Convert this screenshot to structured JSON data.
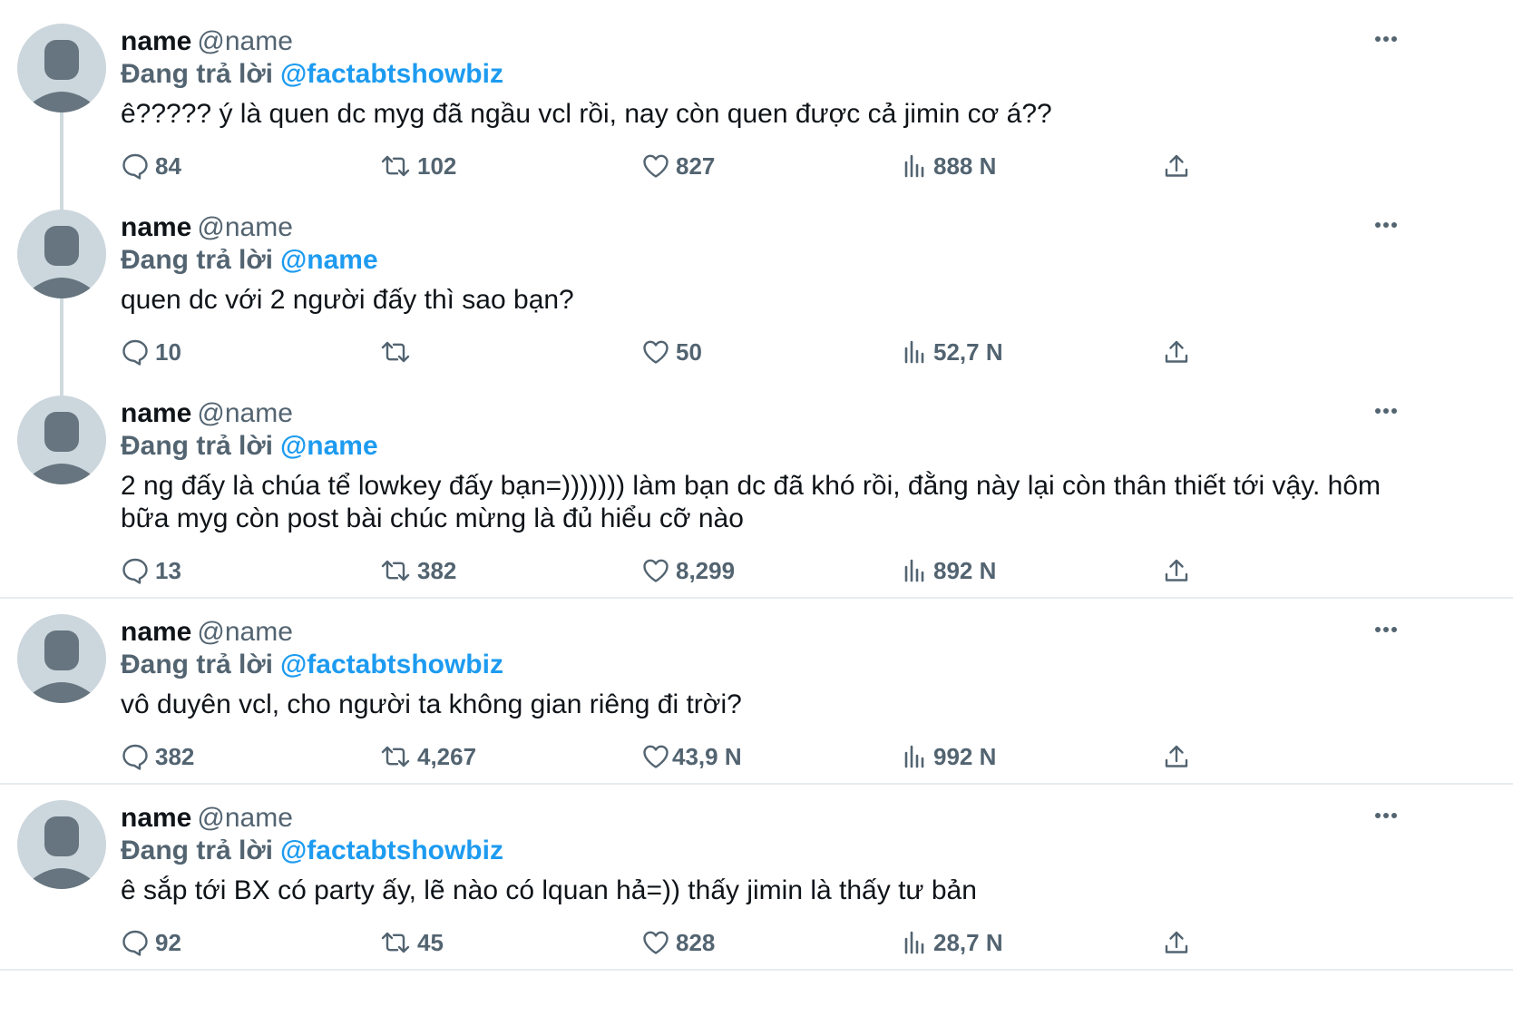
{
  "tweets": [
    {
      "name": "name",
      "handle": "@name",
      "reply_prefix": "Đang trả lời",
      "reply_to": "@factabtshowbiz",
      "text": "ê????? ý là quen dc myg đã ngầu vcl rồi, nay còn quen được cả jimin cơ á??",
      "replies": "84",
      "retweets": "102",
      "likes": "827",
      "views": "888 N"
    },
    {
      "name": "name",
      "handle": "@name",
      "reply_prefix": "Đang trả lời",
      "reply_to": "@name",
      "text": "quen dc với 2 người đấy thì sao bạn?",
      "replies": "10",
      "retweets": "",
      "likes": "50",
      "views": "52,7 N"
    },
    {
      "name": "name",
      "handle": "@name",
      "reply_prefix": "Đang trả lời",
      "reply_to": "@name",
      "text": "2 ng đấy là chúa tể lowkey đấy bạn=))))))) làm bạn dc đã khó rồi, đằng này lại còn thân thiết tới vậy. hôm bữa myg còn post bài chúc mừng là đủ hiểu cỡ nào",
      "replies": "13",
      "retweets": "382",
      "likes": "8,299",
      "views": "892 N"
    },
    {
      "name": "name",
      "handle": "@name",
      "reply_prefix": "Đang trả lời",
      "reply_to": "@factabtshowbiz",
      "text": "vô duyên vcl, cho người ta không gian riêng đi trời?",
      "replies": "382",
      "retweets": "4,267",
      "likes": "43,9 N",
      "views": "992 N"
    },
    {
      "name": "name",
      "handle": "@name",
      "reply_prefix": "Đang trả lời",
      "reply_to": "@factabtshowbiz",
      "text": "ê sắp tới BX có party ấy, lẽ nào có lquan hả=)) thấy jimin là thấy tư bản",
      "replies": "92",
      "retweets": "45",
      "likes": "828",
      "views": "28,7 N"
    }
  ],
  "icons": {
    "reply": "speech-bubble-icon",
    "retweet": "retweet-arrows-icon",
    "like": "heart-icon",
    "views": "bar-chart-icon",
    "share": "share-upload-icon",
    "more": "ellipsis-icon",
    "avatar": "default-avatar-icon"
  },
  "colors": {
    "mention": "#1d9bf0",
    "secondary": "#536471",
    "avatar_bg": "#ccd6dd",
    "avatar_fg": "#66757f",
    "thread_line": "#cfd9de",
    "divider": "#e6ecf0"
  }
}
